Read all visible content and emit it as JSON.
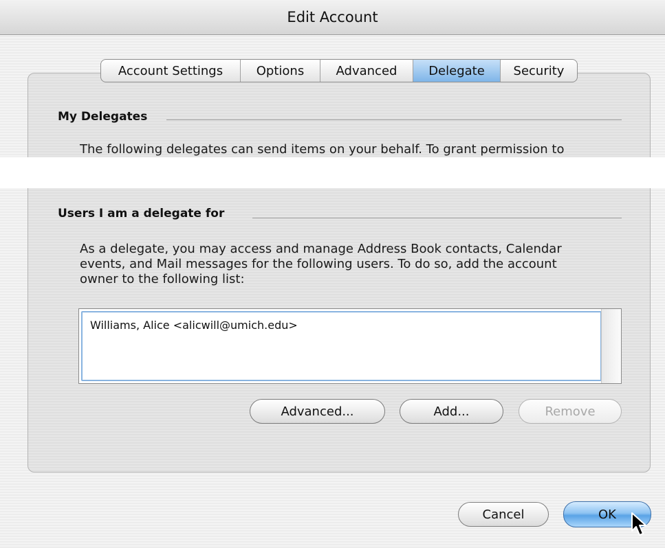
{
  "window": {
    "title": "Edit Account"
  },
  "tabs": [
    {
      "label": "Account Settings"
    },
    {
      "label": "Options"
    },
    {
      "label": "Advanced"
    },
    {
      "label": "Delegate",
      "active": true
    },
    {
      "label": "Security"
    }
  ],
  "my_delegates": {
    "heading": "My Delegates",
    "description": "The following delegates can send items on your behalf. To grant permission to"
  },
  "delegate_for": {
    "heading": "Users I am a delegate for",
    "description_line1": "As a delegate, you may access and manage Address Book contacts, Calendar",
    "description_line2": "events, and Mail messages for the following users. To do so, add the account",
    "description_line3": "owner to the following list:",
    "users": [
      "Williams, Alice <alicwill@umich.edu>"
    ],
    "buttons": {
      "advanced": "Advanced...",
      "add": "Add...",
      "remove": "Remove"
    }
  },
  "footer": {
    "cancel": "Cancel",
    "ok": "OK"
  },
  "colors": {
    "active_tab": "#7fb5e8",
    "default_button": "#5aa3e6",
    "focus_ring": "#88b3e0"
  }
}
